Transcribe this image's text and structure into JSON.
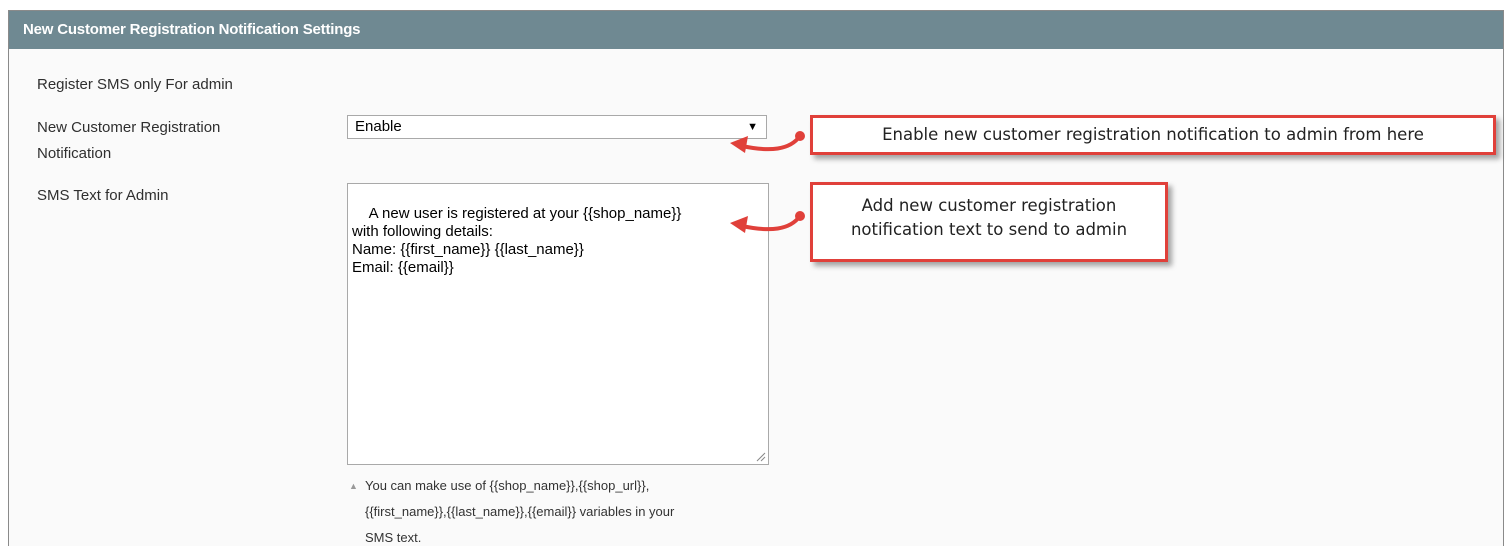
{
  "section": {
    "title": "New Customer Registration Notification Settings"
  },
  "fields": {
    "register_label": "Register SMS only For admin",
    "notification_label_line1": "New Customer Registration",
    "notification_label_line2": "Notification",
    "notification_value": "Enable",
    "sms_text_label": "SMS Text for Admin",
    "sms_text_value": "A new user is registered at your {{shop_name}}\nwith following details:\nName: {{first_name}} {{last_name}}\nEmail: {{email}}",
    "note_line1": "You can make use of {{shop_name}},{{shop_url}},",
    "note_line2": "{{first_name}},{{last_name}},{{email}} variables in your",
    "note_line3": "SMS text."
  },
  "callouts": {
    "enable_text": "Enable new customer registration notification to admin from here",
    "sms_text_line1": "Add new customer registration",
    "sms_text_line2": "notification text to send to admin"
  },
  "colors": {
    "header_bg": "#6f8992",
    "callout_border": "#e0403a",
    "arrow": "#e0403a"
  },
  "icons": {
    "select_arrow": "dropdown-triangle",
    "note_marker": "triangle-up"
  }
}
